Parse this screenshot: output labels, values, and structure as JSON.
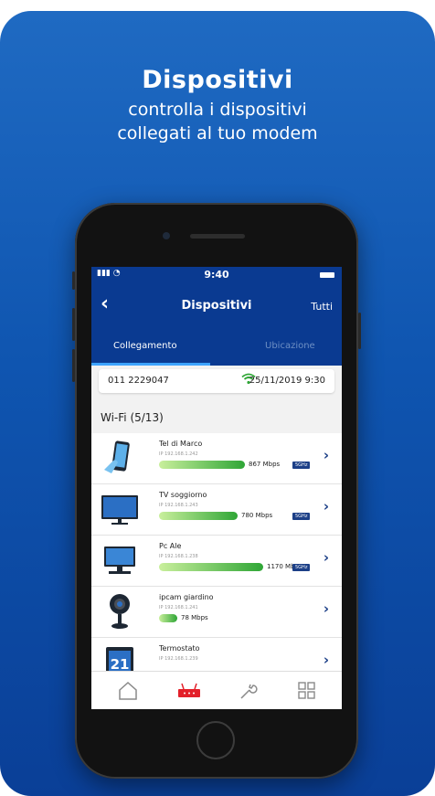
{
  "promo": {
    "title": "Dispositivi",
    "subtitle_line1": "controlla i dispositivi",
    "subtitle_line2": "collegati al tuo modem"
  },
  "status_bar": {
    "time": "9:40"
  },
  "navbar": {
    "title": "Dispositivi",
    "right_action": "Tutti"
  },
  "tabs": [
    {
      "label": "Collegamento",
      "active": true
    },
    {
      "label": "Ubicazione",
      "active": false
    }
  ],
  "connection": {
    "phone_number": "011 2229047",
    "timestamp": "25/11/2019 9:30"
  },
  "section": {
    "label": "Wi-Fi (5/13)"
  },
  "devices": [
    {
      "name": "Tel di Marco",
      "ip": "IP 192.168.1.242",
      "speed": "867 Mbps",
      "speed_fraction": 0.72,
      "band": "5GHz",
      "icon": "smartphone-icon"
    },
    {
      "name": "TV soggiorno",
      "ip": "IP 192.168.1.243",
      "speed": "780 Mbps",
      "speed_fraction": 0.66,
      "band": "5GHz",
      "icon": "tv-icon"
    },
    {
      "name": "Pc Ale",
      "ip": "IP 192.168.1.238",
      "speed": "1170 Mbps",
      "speed_fraction": 0.88,
      "band": "5GHz",
      "icon": "desktop-computer-icon"
    },
    {
      "name": "ipcam giardino",
      "ip": "IP 192.168.1.241",
      "speed": "78 Mbps",
      "speed_fraction": 0.15,
      "band": "",
      "icon": "ip-camera-icon"
    },
    {
      "name": "Termostato",
      "ip": "IP 192.168.1.239",
      "speed": "",
      "speed_fraction": 0.0,
      "band": "",
      "icon": "thermostat-icon"
    }
  ],
  "thermostat_display": "21",
  "bottom_tabs": [
    {
      "icon": "home-icon",
      "active": false
    },
    {
      "icon": "modem-icon",
      "active": true
    },
    {
      "icon": "wrench-icon",
      "active": false
    },
    {
      "icon": "grid-icon",
      "active": false
    }
  ],
  "colors": {
    "brand_dark": "#0a3a91",
    "accent_blue": "#3da3ff",
    "wifi_green": "#2fa636",
    "modem_red": "#e3202a",
    "band_badge": "#1c3f87"
  }
}
